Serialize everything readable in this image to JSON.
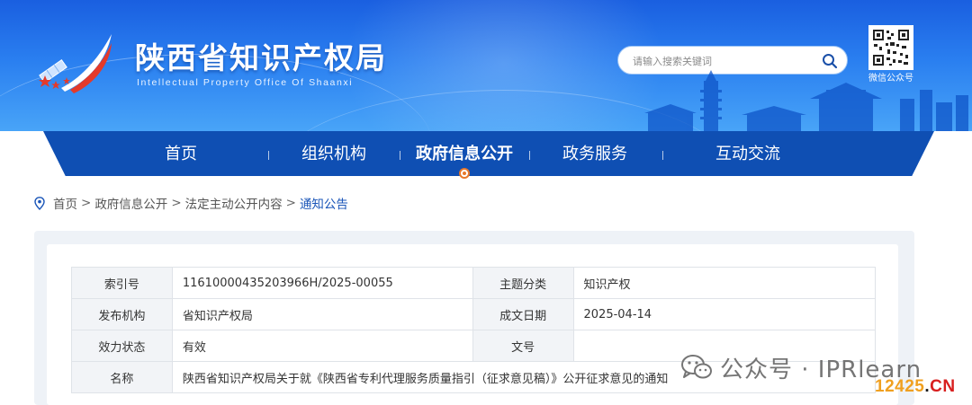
{
  "header": {
    "title": "陕西省知识产权局",
    "subtitle": "Intellectual Property Office Of Shaanxi",
    "search": {
      "placeholder": "请输入搜索关键词"
    },
    "qr_label": "微信公众号"
  },
  "nav": {
    "items": [
      {
        "label": "首页"
      },
      {
        "label": "组织机构"
      },
      {
        "label": "政府信息公开"
      },
      {
        "label": "政务服务"
      },
      {
        "label": "互动交流"
      }
    ],
    "active_index": 2
  },
  "breadcrumb": {
    "items": [
      "首页",
      "政府信息公开",
      "法定主动公开内容",
      "通知公告"
    ],
    "separator": ">"
  },
  "meta": {
    "index_no_label": "索引号",
    "index_no_value": "11610000435203966H/2025-00055",
    "topic_label": "主题分类",
    "topic_value": "知识产权",
    "issuer_label": "发布机构",
    "issuer_value": "省知识产权局",
    "date_label": "成文日期",
    "date_value": "2025-04-14",
    "status_label": "效力状态",
    "status_value": "有效",
    "doc_no_label": "文号",
    "doc_no_value": "",
    "name_label": "名称",
    "name_value": "陕西省知识产权局关于就《陕西省专利代理服务质量指引（征求意见稿）》公开征求意见的通知"
  },
  "watermark": {
    "text": "公众号 · IPRlearn",
    "site_num": "12425",
    "site_dot": ".",
    "site_cn": "CN"
  },
  "colors": {
    "header_blue": "#1a5fe0",
    "nav_blue": "#0f4fb3",
    "link_blue": "#1a55b8",
    "accent_orange": "#e8782a"
  }
}
